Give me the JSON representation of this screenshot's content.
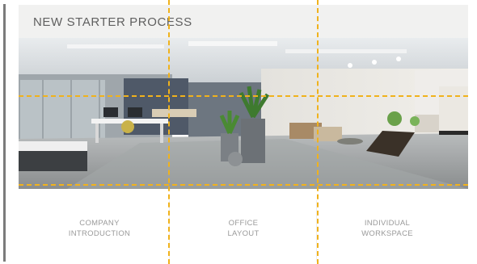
{
  "header": {
    "title": "NEW STARTER PROCESS"
  },
  "photo": {
    "subject": "modern open-plan office interior"
  },
  "cards": [
    {
      "line1": "COMPANY",
      "line2": "INTRODUCTION"
    },
    {
      "line1": "OFFICE",
      "line2": "LAYOUT"
    },
    {
      "line1": "INDIVIDUAL",
      "line2": "WORKSPACE"
    }
  ],
  "colors": {
    "guide": "#f0b21c",
    "header_bg": "#f1f1f0",
    "label_text": "#9a9a9a"
  }
}
